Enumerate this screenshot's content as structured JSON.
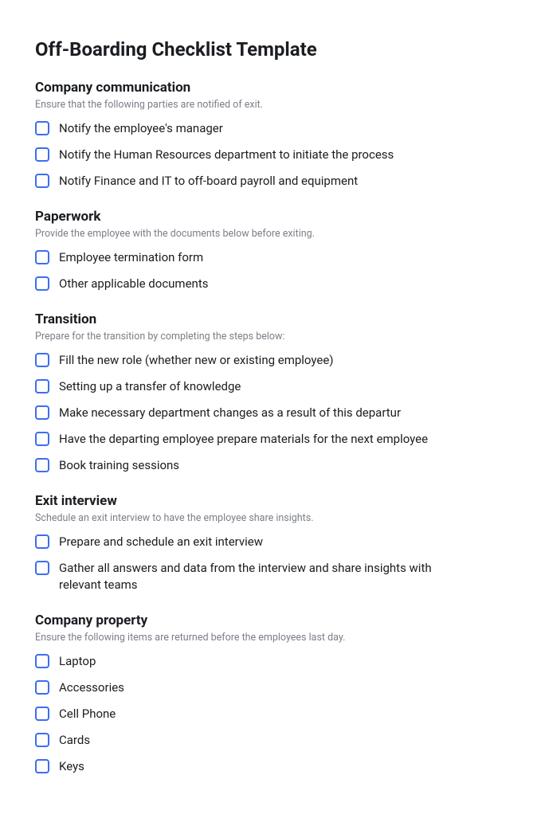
{
  "title": "Off-Boarding Checklist Template",
  "sections": [
    {
      "title": "Company communication",
      "subtitle": "Ensure that the following parties are notified of exit.",
      "items": [
        "Notify the employee's manager",
        "Notify the Human Resources department to initiate the process",
        "Notify Finance and IT to off-board payroll and equipment"
      ]
    },
    {
      "title": "Paperwork",
      "subtitle": "Provide the employee with the documents below before exiting.",
      "items": [
        "Employee termination form",
        "Other applicable documents"
      ]
    },
    {
      "title": "Transition",
      "subtitle": "Prepare for the transition by completing the steps below:",
      "items": [
        "Fill the new role (whether new or existing employee)",
        "Setting up a transfer of knowledge",
        "Make necessary department changes as a result of this departur",
        "Have the departing employee prepare materials for the next employee",
        "Book training sessions"
      ]
    },
    {
      "title": "Exit interview",
      "subtitle": "Schedule an exit interview to have the employee share insights.",
      "items": [
        "Prepare and schedule an exit interview",
        "Gather all answers and data from the interview and share insights with relevant teams"
      ]
    },
    {
      "title": "Company property",
      "subtitle": "Ensure the following items are returned before the employees last day.",
      "items": [
        "Laptop",
        "Accessories",
        "Cell Phone",
        "Cards",
        "Keys"
      ]
    }
  ]
}
